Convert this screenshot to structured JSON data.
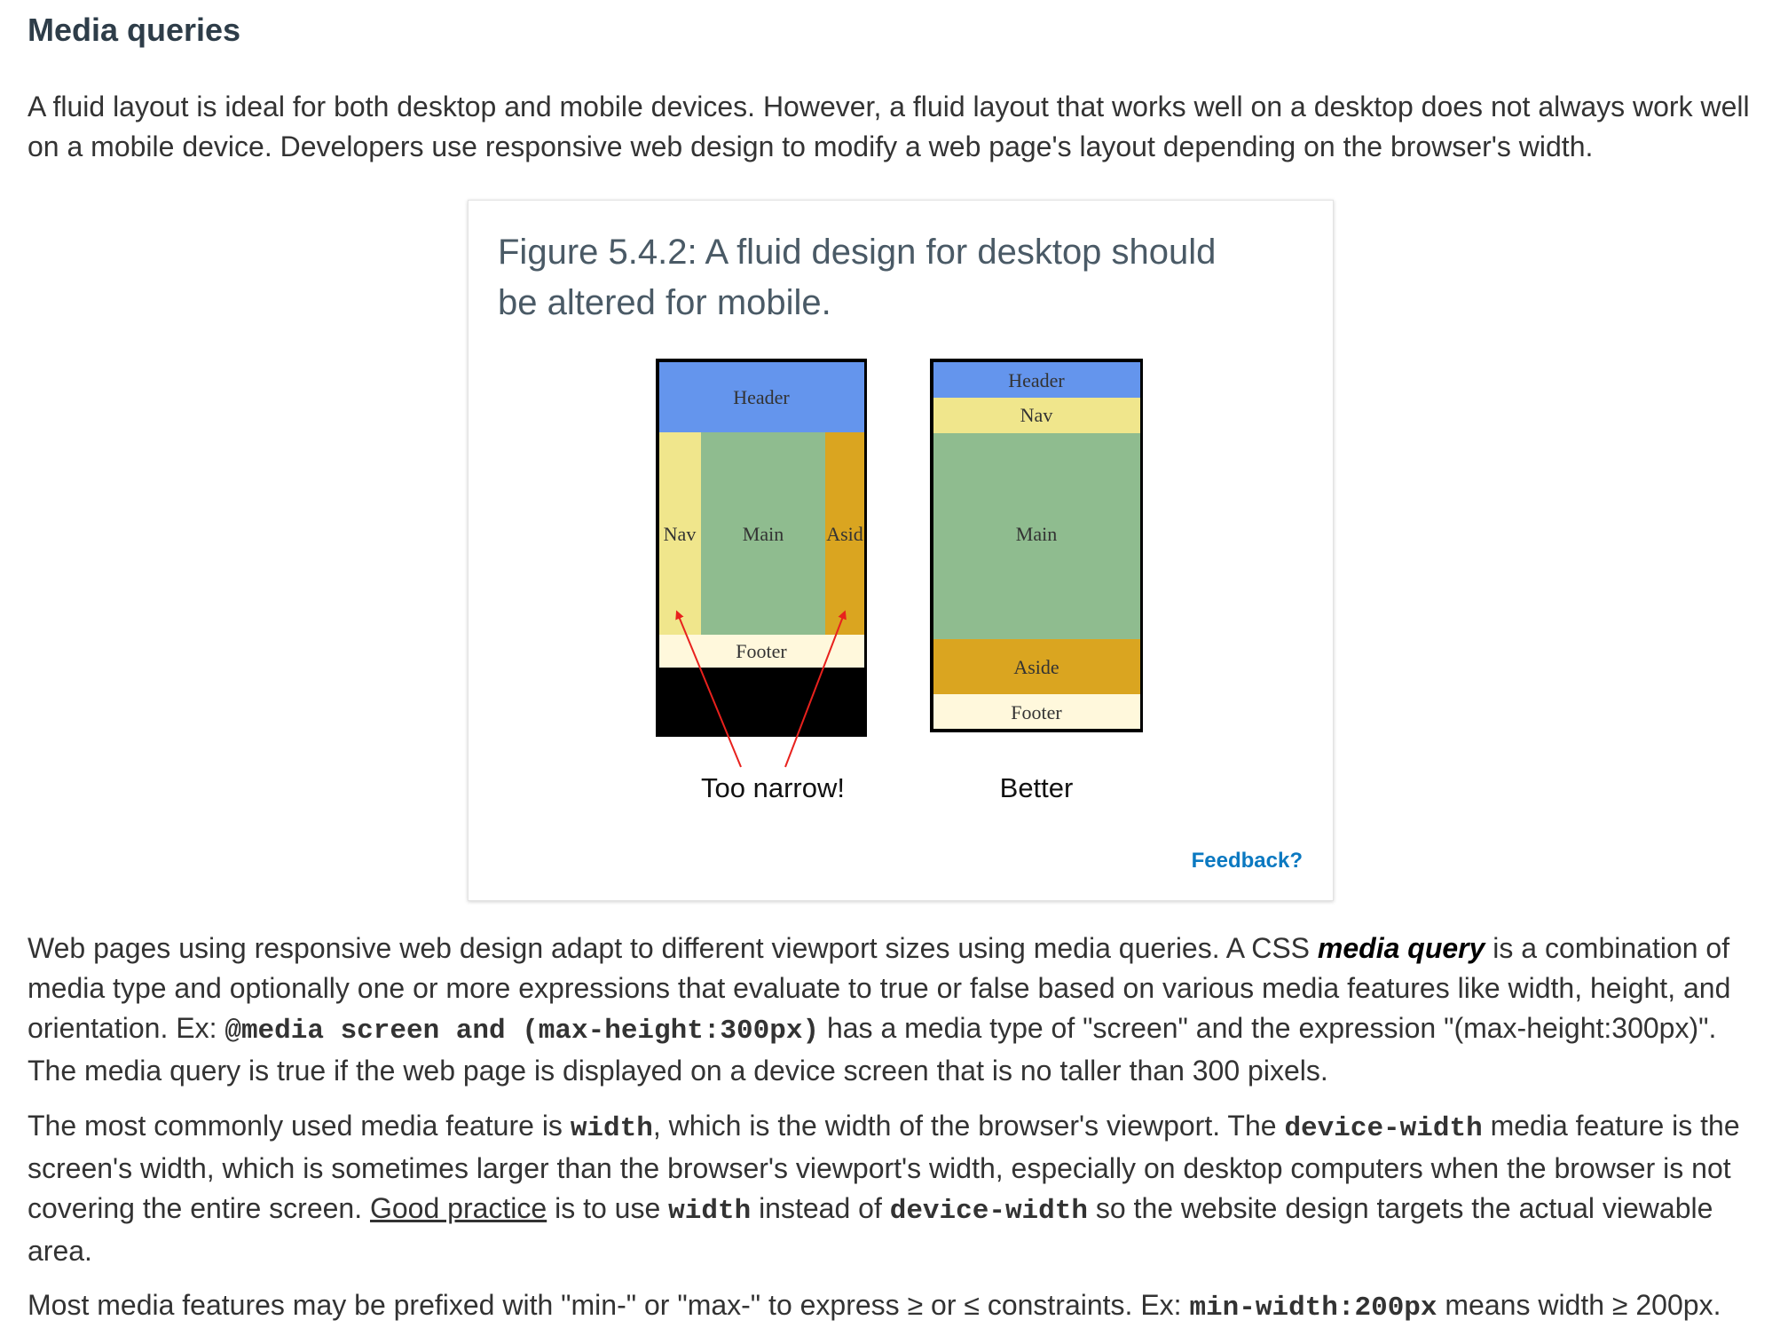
{
  "section": {
    "title": "Media queries"
  },
  "intro": {
    "text": "A fluid layout is ideal for both desktop and mobile devices. However, a fluid layout that works well on a desktop does not always work well on a mobile device. Developers use responsive web design to modify a web page's layout depending on the browser's width."
  },
  "figure": {
    "caption": "Figure 5.4.2: A fluid design for desktop should be altered for mobile.",
    "left": {
      "header": "Header",
      "nav": "Nav",
      "main": "Main",
      "aside": "Asid",
      "footer": "Footer",
      "label": "Too narrow!"
    },
    "right": {
      "header": "Header",
      "nav": "Nav",
      "main": "Main",
      "aside": "Aside",
      "footer": "Footer",
      "label": "Better"
    },
    "feedback": "Feedback?",
    "colors": {
      "header": "#6495ed",
      "nav": "#f0e68c",
      "main": "#8fbc8f",
      "aside": "#daa520",
      "footer": "#fff8dc",
      "border": "#000000",
      "arrow": "#e8211d"
    }
  },
  "para2": {
    "t1": "Web pages using responsive web design adapt to different viewport sizes using media queries. A CSS ",
    "term": "media query",
    "t2": " is a combination of media type and optionally one or more expressions that evaluate to true or false based on various media features like width, height, and orientation. Ex: ",
    "code1": "@media screen and (max-height:300px)",
    "t3": " has a media type of \"screen\" and the expression \"(max-height:300px)\". The media query is true if the web page is displayed on a device screen that is no taller than 300 pixels."
  },
  "para3": {
    "t1": "The most commonly used media feature is ",
    "code1": "width",
    "t2": ", which is the width of the browser's viewport. The ",
    "code2": "device-width",
    "t3": " media feature is the screen's width, which is sometimes larger than the browser's viewport's width, especially on desktop computers when the browser is not covering the entire screen. ",
    "link": "Good practice",
    "t4": " is to use ",
    "code3": "width",
    "t5": " instead of ",
    "code4": "device-width",
    "t6": " so the website design targets the actual viewable area."
  },
  "para4": {
    "t1": "Most media features may be prefixed with \"min-\" or \"max-\" to express ≥ or ≤ constraints. Ex: ",
    "code1": "min-width:200px",
    "t2": " means width ≥ 200px."
  }
}
